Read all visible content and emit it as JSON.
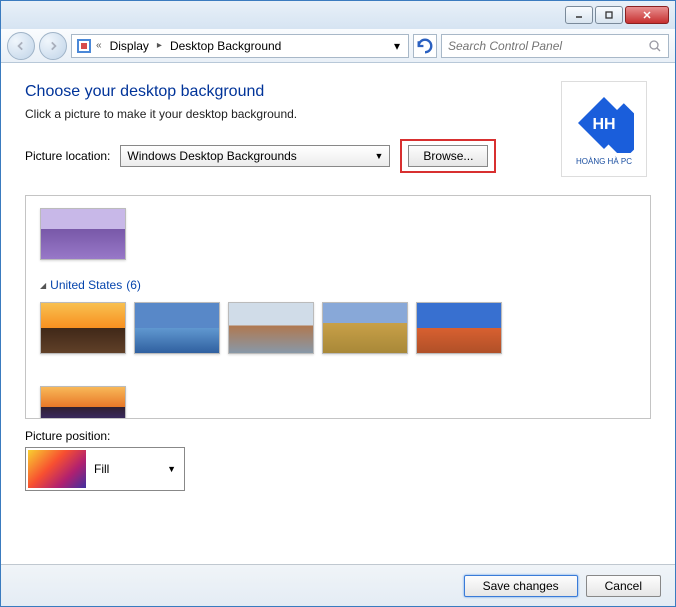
{
  "breadcrumbs": {
    "root": "Display",
    "current": "Desktop Background"
  },
  "search": {
    "placeholder": "Search Control Panel"
  },
  "heading": "Choose your desktop background",
  "subtext": "Click a picture to make it your desktop background.",
  "location": {
    "label": "Picture location:",
    "value": "Windows Desktop Backgrounds",
    "browse": "Browse..."
  },
  "logo": {
    "brand": "HOÀNG HÀ PC"
  },
  "group": {
    "name": "United States",
    "count": "(6)"
  },
  "position": {
    "label": "Picture position:",
    "value": "Fill"
  },
  "footer": {
    "save": "Save changes",
    "cancel": "Cancel"
  }
}
